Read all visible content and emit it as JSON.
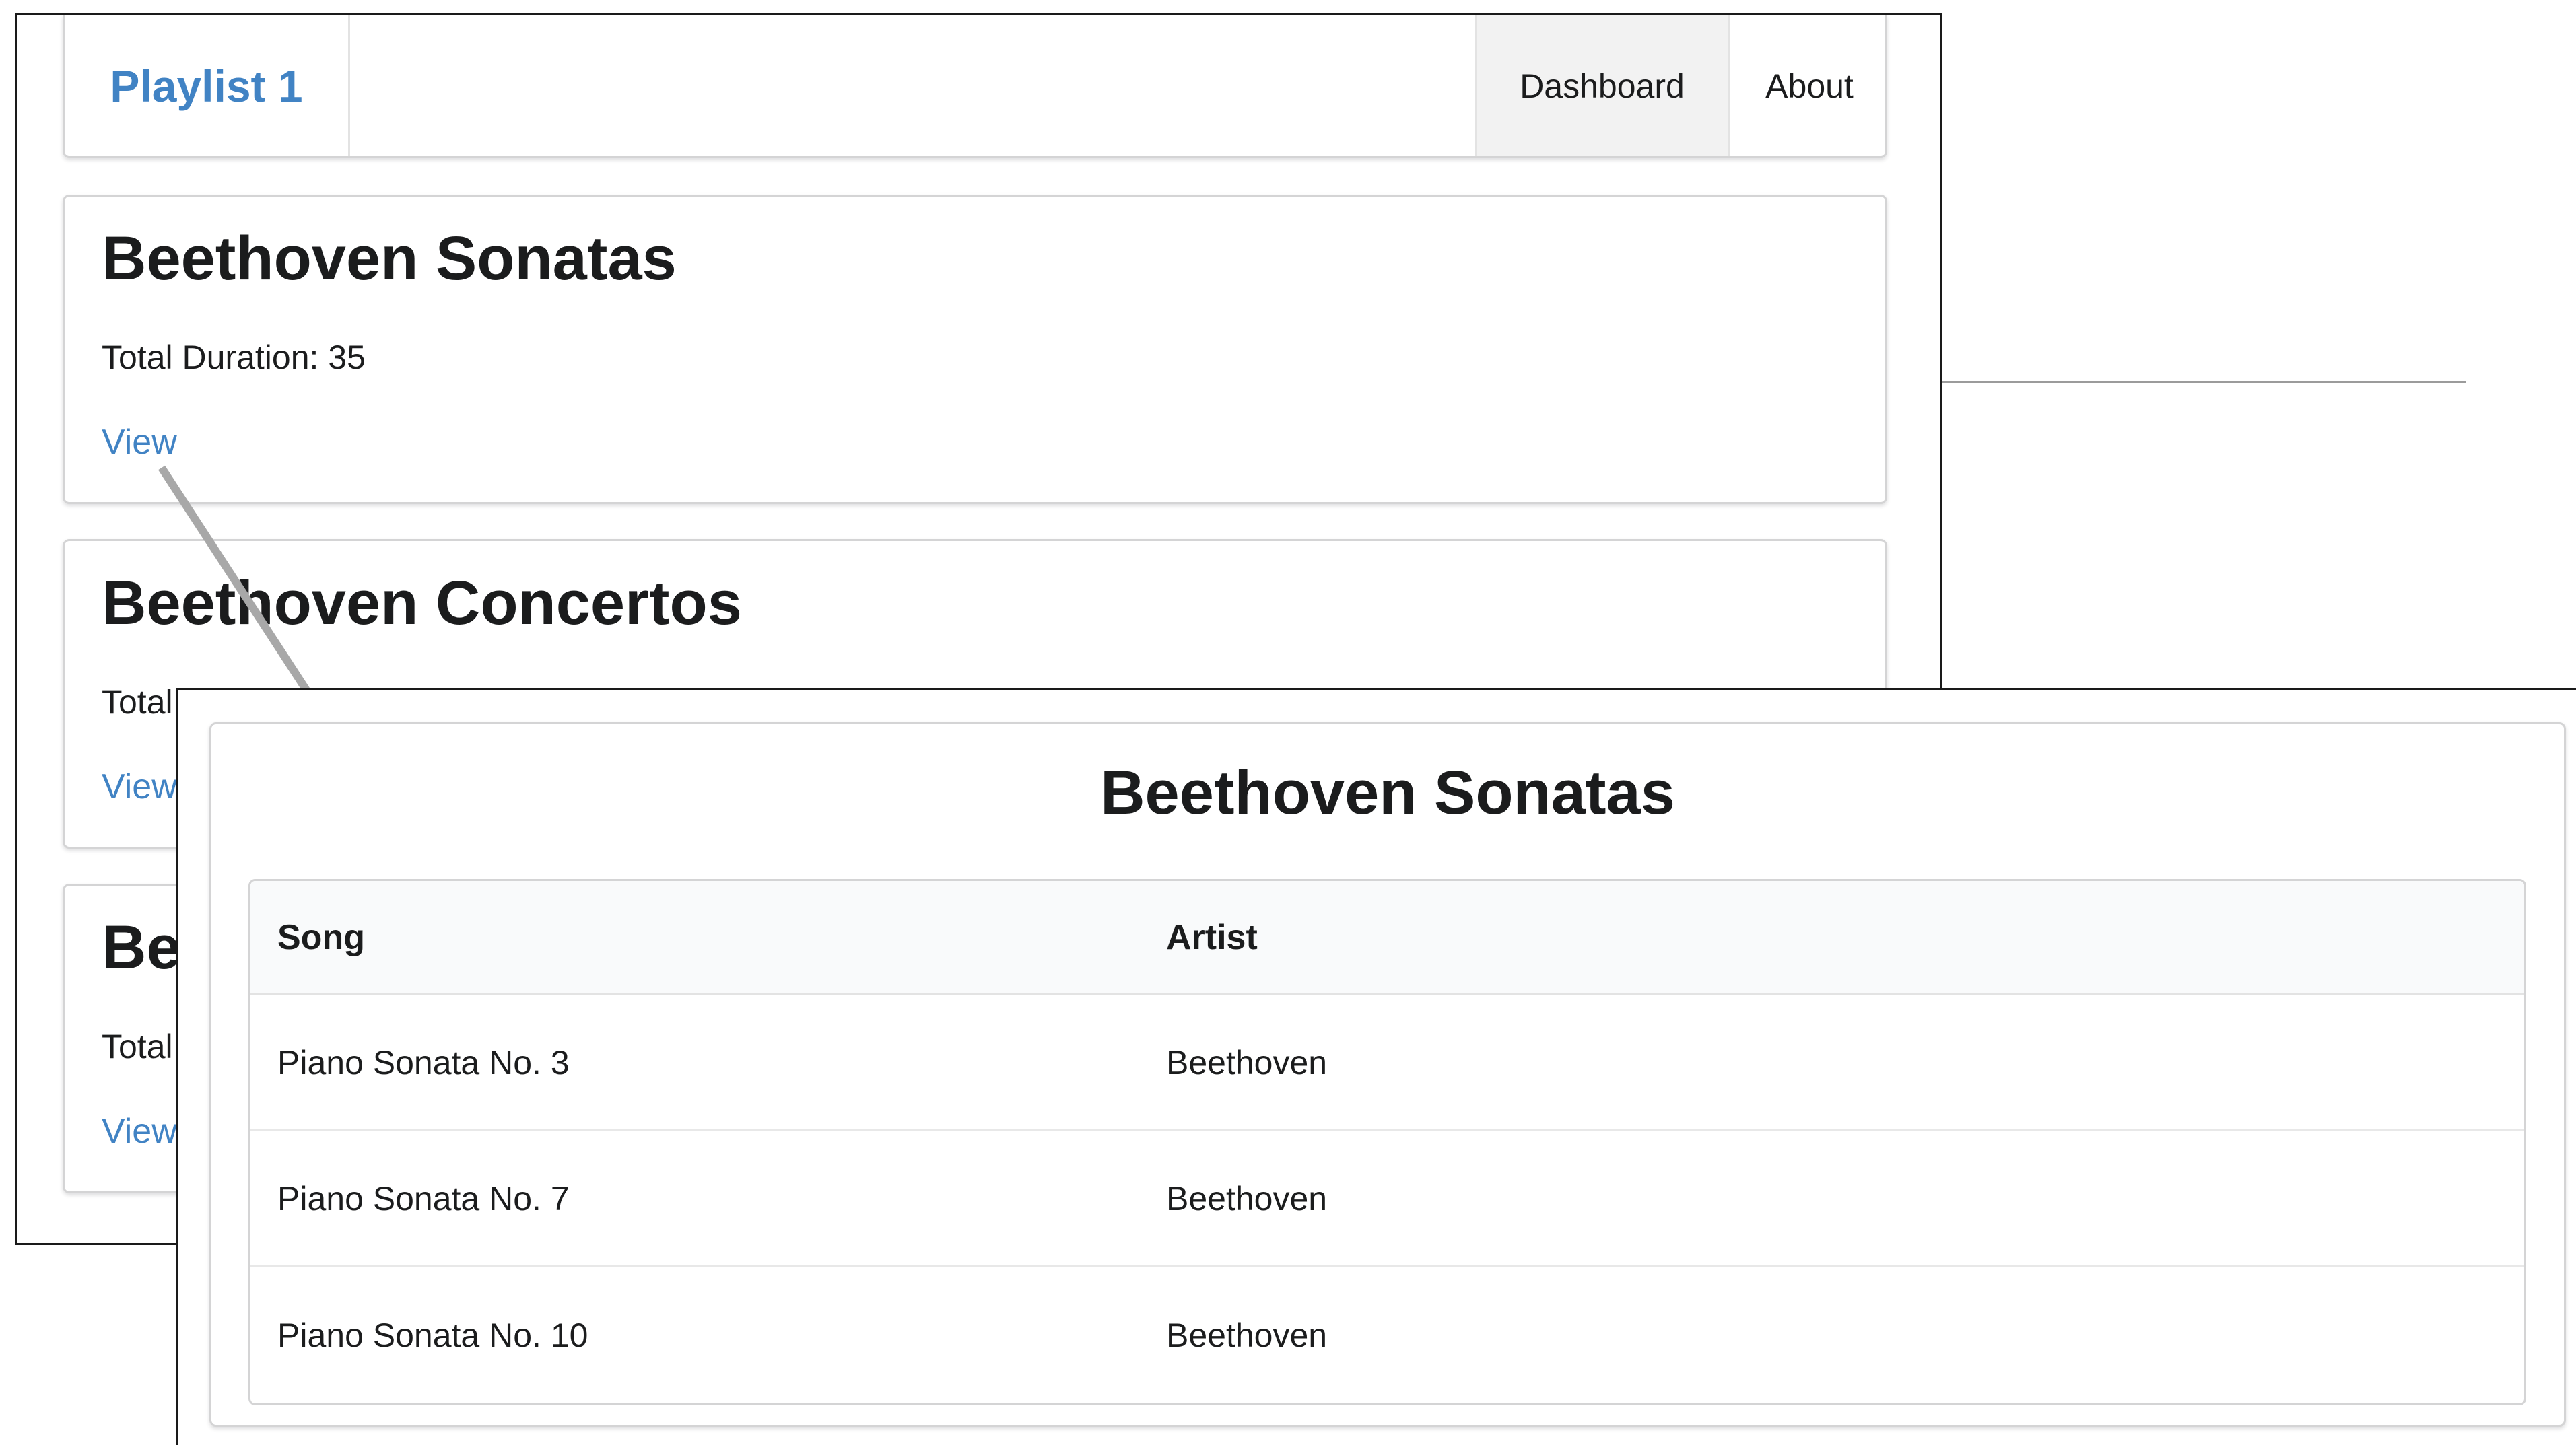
{
  "nav": {
    "brand": "Playlist 1",
    "items": [
      {
        "label": "Dashboard",
        "active": true
      },
      {
        "label": "About",
        "active": false
      }
    ]
  },
  "playlists": [
    {
      "title": "Beethoven Sonatas",
      "meta": "Total Duration: 35",
      "link": "View"
    },
    {
      "title": "Beethoven Concertos",
      "meta": "Total",
      "link": "View"
    },
    {
      "title": "Be",
      "meta": "Total",
      "link": "View"
    }
  ],
  "detail": {
    "title": "Beethoven Sonatas",
    "columns": [
      "Song",
      "Artist"
    ],
    "rows": [
      {
        "song": "Piano Sonata No. 3",
        "artist": "Beethoven"
      },
      {
        "song": "Piano Sonata No. 7",
        "artist": "Beethoven"
      },
      {
        "song": "Piano Sonata No. 10",
        "artist": "Beethoven"
      }
    ]
  },
  "colors": {
    "link": "#4183c4",
    "text": "#1b1c1d",
    "border": "#d4d4d5",
    "active_bg": "#f2f2f2",
    "header_bg": "#f9fafb"
  }
}
